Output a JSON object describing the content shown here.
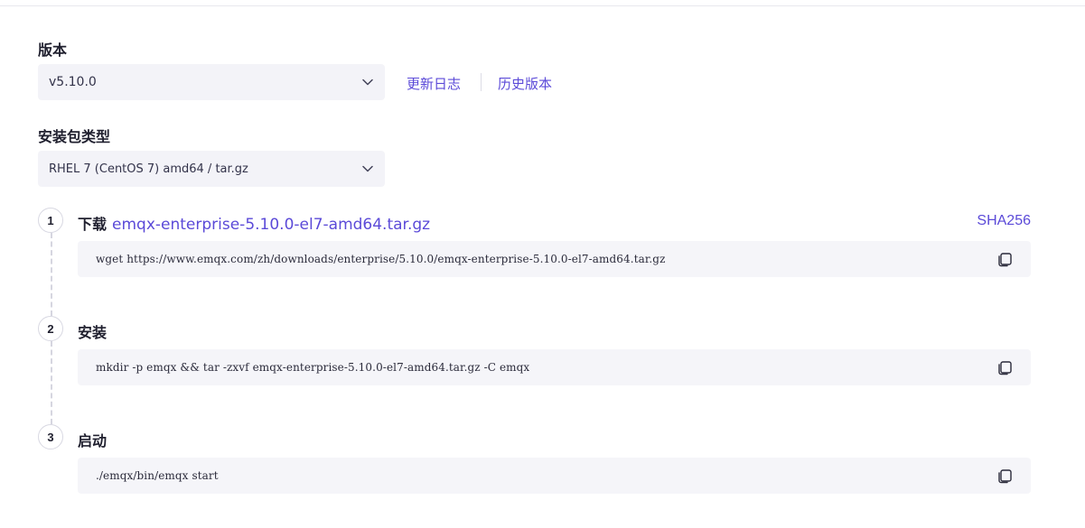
{
  "version": {
    "label": "版本",
    "selected": "v5.10.0",
    "changelog_link": "更新日志",
    "history_link": "历史版本"
  },
  "package": {
    "label": "安装包类型",
    "selected": "RHEL 7 (CentOS 7) amd64 / tar.gz"
  },
  "steps": [
    {
      "number": "1",
      "title": "下载",
      "file_link": "emqx-enterprise-5.10.0-el7-amd64.tar.gz",
      "sha_link": "SHA256",
      "command": "wget https://www.emqx.com/zh/downloads/enterprise/5.10.0/emqx-enterprise-5.10.0-el7-amd64.tar.gz"
    },
    {
      "number": "2",
      "title": "安装",
      "command": "mkdir -p emqx && tar -zxvf emqx-enterprise-5.10.0-el7-amd64.tar.gz -C emqx"
    },
    {
      "number": "3",
      "title": "启动",
      "command": "./emqx/bin/emqx start"
    }
  ],
  "colors": {
    "accent": "#5b4ad8",
    "field_bg": "#f3f3f8",
    "code_bg": "#f5f5f9"
  },
  "icons": {
    "chevron": "chevron-down-icon",
    "copy": "copy-icon"
  }
}
